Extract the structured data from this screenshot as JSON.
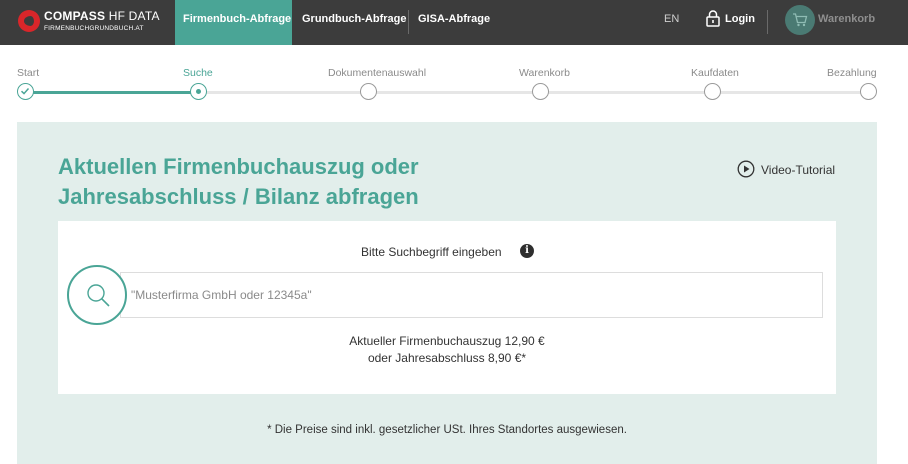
{
  "brand": {
    "name_bold": "COMPASS",
    "name_light": "HF DATA",
    "domain": "FIRMENBUCHGRUNDBUCH.AT"
  },
  "nav": {
    "tabs": [
      {
        "label": "Firmenbuch-Abfrage",
        "active": true
      },
      {
        "label": "Grundbuch-Abfrage",
        "active": false
      },
      {
        "label": "GISA-Abfrage",
        "active": false
      }
    ],
    "language": "EN",
    "login_label": "Login",
    "cart_label": "Warenkorb"
  },
  "stepper": {
    "steps": [
      {
        "label": "Start",
        "state": "done"
      },
      {
        "label": "Suche",
        "state": "current"
      },
      {
        "label": "Dokumentenauswahl",
        "state": "pending"
      },
      {
        "label": "Warenkorb",
        "state": "pending"
      },
      {
        "label": "Kaufdaten",
        "state": "pending"
      },
      {
        "label": "Bezahlung",
        "state": "pending"
      }
    ]
  },
  "main": {
    "title_line1": "Aktuellen Firmenbuchauszug oder",
    "title_line2": "Jahresabschluss / Bilanz abfragen",
    "video_label": "Video-Tutorial",
    "search_hint": "Bitte Suchbegriff eingeben",
    "search_placeholder": "\"Musterfirma GmbH oder 12345a\"",
    "price_line1": "Aktueller Firmenbuchauszug 12,90 €",
    "price_line2": "oder Jahresabschluss 8,90 €*",
    "footnote": "* Die Preise sind inkl. gesetzlicher USt. Ihres Standortes ausgewiesen."
  },
  "colors": {
    "accent": "#4aa596",
    "nav_bg": "#3c3c3c",
    "panel_bg": "#e2eeeb",
    "brand_red": "#d9262a"
  },
  "icons": [
    "play-circle-icon",
    "info-icon",
    "search-icon",
    "lock-icon",
    "cart-icon",
    "check-icon"
  ]
}
